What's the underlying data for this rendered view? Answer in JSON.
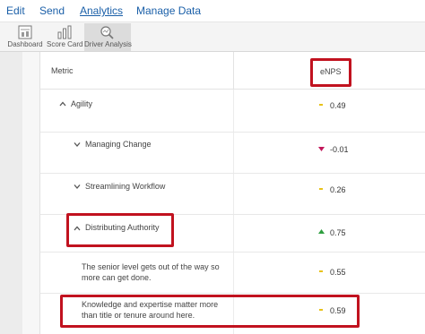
{
  "menu": {
    "items": [
      {
        "label": "Edit"
      },
      {
        "label": "Send"
      },
      {
        "label": "Analytics"
      },
      {
        "label": "Manage Data"
      }
    ]
  },
  "toolbar": {
    "tools": [
      {
        "label": "Dashboard",
        "icon": "dashboard-icon"
      },
      {
        "label": "Score Card",
        "icon": "scorecard-icon"
      },
      {
        "label": "Driver Analysis",
        "icon": "driver-analysis-icon"
      }
    ],
    "selected": "Driver Analysis"
  },
  "table": {
    "header": {
      "metric": "Metric",
      "enps": "eNPS"
    },
    "rows": [
      {
        "label": "Agility",
        "value": "0.49",
        "indicator": "neutral",
        "chevron": "up"
      },
      {
        "label": "Managing Change",
        "value": "-0.01",
        "indicator": "down",
        "chevron": "down"
      },
      {
        "label": "Streamlining Workflow",
        "value": "0.26",
        "indicator": "neutral",
        "chevron": "down"
      },
      {
        "label": "Distributing Authority",
        "value": "0.75",
        "indicator": "up",
        "chevron": "up"
      },
      {
        "label": "The senior level gets out of the way so more can get done.",
        "value": "0.55",
        "indicator": "neutral"
      },
      {
        "label": "Knowledge and expertise matter more than title or tenure around here.",
        "value": "0.59",
        "indicator": "neutral"
      }
    ]
  },
  "colors": {
    "link": "#1a5fa8",
    "highlight": "#c1121f",
    "up": "#2e9e3f",
    "down": "#c2185b",
    "neutral": "#e8c21a"
  }
}
